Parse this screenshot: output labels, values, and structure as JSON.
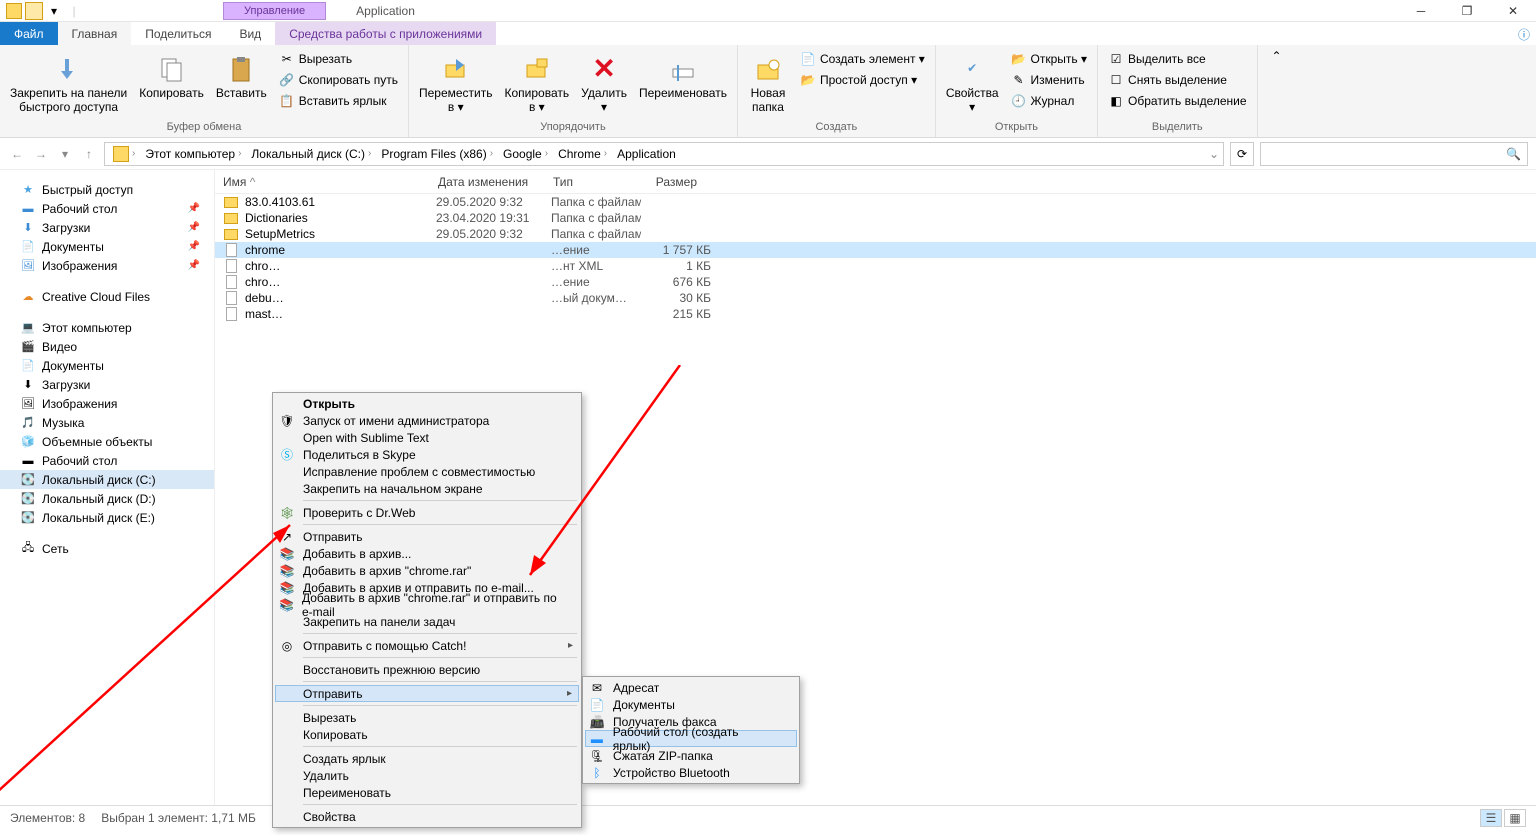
{
  "window": {
    "manage_tab": "Управление",
    "title": "Application"
  },
  "tabs": {
    "file": "Файл",
    "home": "Главная",
    "share": "Поделиться",
    "view": "Вид",
    "tools": "Средства работы с приложениями"
  },
  "ribbon": {
    "groups": {
      "clipboard": "Буфер обмена",
      "organize": "Упорядочить",
      "new": "Создать",
      "open": "Открыть",
      "select": "Выделить"
    },
    "pin": "Закрепить на панели\nбыстрого доступа",
    "copy": "Копировать",
    "paste": "Вставить",
    "cut": "Вырезать",
    "copy_path": "Скопировать путь",
    "paste_link": "Вставить ярлык",
    "move": "Переместить\nв ▾",
    "copy_to": "Копировать\nв ▾",
    "delete": "Удалить\n▾",
    "rename": "Переименовать",
    "new_folder": "Новая\nпапка",
    "new_item": "Создать элемент ▾",
    "easy_access": "Простой доступ ▾",
    "properties": "Свойства\n▾",
    "open_btn": "Открыть ▾",
    "edit": "Изменить",
    "history": "Журнал",
    "select_all": "Выделить все",
    "deselect": "Снять выделение",
    "invert": "Обратить выделение"
  },
  "breadcrumb": [
    "Этот компьютер",
    "Локальный диск (C:)",
    "Program Files (x86)",
    "Google",
    "Chrome",
    "Application"
  ],
  "columns": {
    "name": "Имя",
    "date": "Дата изменения",
    "type": "Тип",
    "size": "Размер"
  },
  "nav": {
    "quick": "Быстрый доступ",
    "desktop": "Рабочий стол",
    "downloads": "Загрузки",
    "documents": "Документы",
    "pictures": "Изображения",
    "ccf": "Creative Cloud Files",
    "thispc": "Этот компьютер",
    "videos": "Видео",
    "documents2": "Документы",
    "downloads2": "Загрузки",
    "pictures2": "Изображения",
    "music": "Музыка",
    "objects3d": "Объемные объекты",
    "desktop2": "Рабочий стол",
    "diskc": "Локальный диск (C:)",
    "diskd": "Локальный диск (D:)",
    "diske": "Локальный диск (E:)",
    "network": "Сеть"
  },
  "files": [
    {
      "name": "83.0.4103.61",
      "date": "29.05.2020 9:32",
      "type": "Папка с файлами",
      "size": ""
    },
    {
      "name": "Dictionaries",
      "date": "23.04.2020 19:31",
      "type": "Папка с файлами",
      "size": ""
    },
    {
      "name": "SetupMetrics",
      "date": "29.05.2020 9:32",
      "type": "Папка с файлами",
      "size": ""
    },
    {
      "name": "chrome",
      "date": "",
      "type": "…ение",
      "size": "1 757 КБ",
      "selected": true
    },
    {
      "name": "chro…",
      "date": "",
      "type": "…нт XML",
      "size": "1 КБ"
    },
    {
      "name": "chro…",
      "date": "",
      "type": "…ение",
      "size": "676 КБ"
    },
    {
      "name": "debu…",
      "date": "",
      "type": "…ый докум…",
      "size": "30 КБ"
    },
    {
      "name": "mast…",
      "date": "",
      "type": "",
      "size": "215 КБ"
    }
  ],
  "ctx": {
    "open": "Открыть",
    "run_admin": "Запуск от имени администратора",
    "sublime": "Open with Sublime Text",
    "skype": "Поделиться в Skype",
    "compat": "Исправление проблем с совместимостью",
    "pin_start": "Закрепить на начальном экране",
    "drweb": "Проверить с Dr.Web",
    "share_generic": "Отправить",
    "rar1": "Добавить в архив...",
    "rar2": "Добавить в архив \"chrome.rar\"",
    "rar3": "Добавить в архив и отправить по e-mail...",
    "rar4": "Добавить в архив \"chrome.rar\" и отправить по e-mail",
    "pin_task": "Закрепить на панели задач",
    "catch": "Отправить с помощью Catch!",
    "restore": "Восстановить прежнюю версию",
    "send_to": "Отправить",
    "cut": "Вырезать",
    "copy": "Копировать",
    "shortcut": "Создать ярлык",
    "delete": "Удалить",
    "rename": "Переименовать",
    "props": "Свойства"
  },
  "sub": {
    "recipient": "Адресат",
    "documents": "Документы",
    "fax": "Получатель факса",
    "desktop_shortcut": "Рабочий стол (создать ярлык)",
    "zip": "Сжатая ZIP-папка",
    "bluetooth": "Устройство Bluetooth"
  },
  "status": {
    "count": "Элементов: 8",
    "selected": "Выбран 1 элемент: 1,71 МБ"
  }
}
